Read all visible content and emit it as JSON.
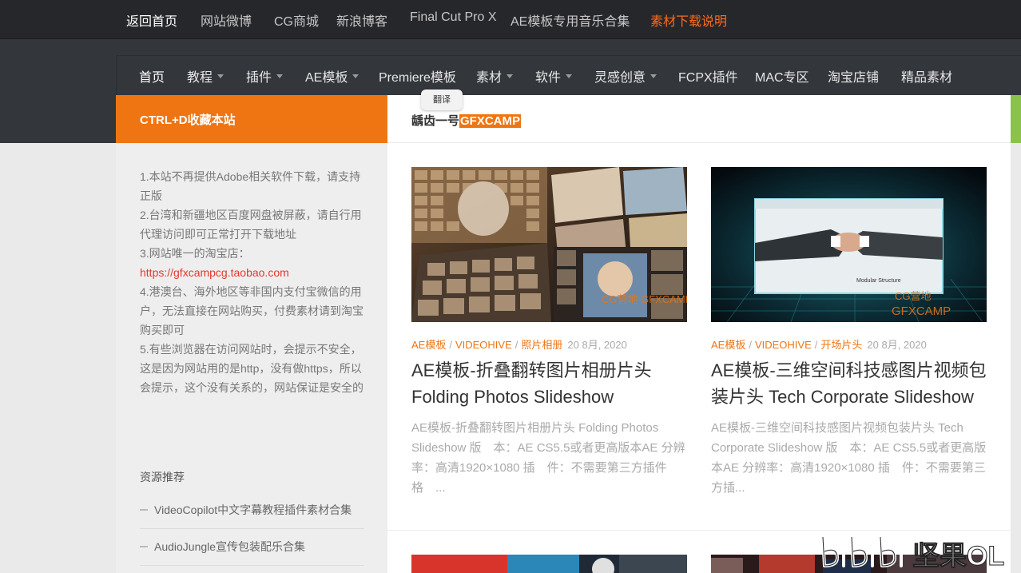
{
  "topbar": {
    "items": [
      {
        "label": "返回首页"
      },
      {
        "label": "网站微博"
      },
      {
        "label": "CG商城"
      },
      {
        "label": "新浪博客"
      },
      {
        "label": "Final Cut Pro X"
      },
      {
        "label": "AE模板专用音乐合集"
      },
      {
        "label": "素材下载说明"
      }
    ]
  },
  "nav": {
    "items": [
      {
        "label": "首页"
      },
      {
        "label": "教程"
      },
      {
        "label": "插件"
      },
      {
        "label": "AE模板"
      },
      {
        "label": "Premiere模板"
      },
      {
        "label": "素材"
      },
      {
        "label": "软件"
      },
      {
        "label": "灵感创意"
      },
      {
        "label": "FCPX插件"
      },
      {
        "label": "MAC专区"
      },
      {
        "label": "淘宝店铺"
      },
      {
        "label": "精品素材"
      }
    ]
  },
  "tooltip": {
    "label": "翻译"
  },
  "sidebar": {
    "heading": "CTRL+D收藏本站",
    "notice": {
      "l1": "1.本站不再提供Adobe相关软件下载，请支持正版",
      "l2": "2.台湾和新疆地区百度网盘被屏蔽，请自行用代理访问即可正常打开下载地址",
      "l3": "3.网站唯一的淘宝店：",
      "link": "https://gfxcampcg.taobao.com",
      "l4": "4.港澳台、海外地区等非国内支付宝微信的用户，无法直接在网站购买，付费素材请到淘宝购买即可",
      "l5": "5.有些浏览器在访问网站时，会提示不安全，这是因为网站用的是http，没有做https，所以会提示，这个没有关系的，网站保证是安全的"
    },
    "resources_title": "资源推荐",
    "resources": [
      {
        "label": "VideoCopilot中文字幕教程插件素材合集"
      },
      {
        "label": "AudioJungle宣传包装配乐合集"
      }
    ]
  },
  "main": {
    "heading_prefix": "龋齿一号",
    "heading_brand": "GFXCAMP",
    "posts": [
      {
        "categories": [
          "AE模板",
          "VIDEOHIVE",
          "照片相册"
        ],
        "date": "20 8月, 2020",
        "title": "AE模板-折叠翻转图片相册片头 Folding Photos Slideshow",
        "excerpt": "AE模板-折叠翻转图片相册片头 Folding Photos Slideshow 版　本：AE CS5.5或者更高版本AE 分辨率：高清1920×1080 插　件：不需要第三方插件 格　..."
      },
      {
        "categories": [
          "AE模板",
          "VIDEOHIVE",
          "开场片头"
        ],
        "date": "20 8月, 2020",
        "title": "AE模板-三维空间科技感图片视频包装片头 Tech Corporate Slideshow",
        "excerpt": "AE模板-三维空间科技感图片视频包装片头 Tech Corporate Slideshow 版　本：AE CS5.5或者更高版本AE 分辨率：高清1920×1080 插　件：不需要第三方插..."
      }
    ],
    "thumb1_overlay": "CG营地 GFXCAMP",
    "thumb2_caption": "Modular Structure",
    "thumb2_overlay1": "CG营地",
    "thumb2_overlay2": "GFXCAMP"
  },
  "watermark": {
    "text": "坚果OL"
  },
  "colors": {
    "accent": "#ef7512",
    "topbar_bg": "#26272b",
    "nav_bg": "#33363b",
    "link": "#e23a2e",
    "green": "#8bc34a"
  }
}
